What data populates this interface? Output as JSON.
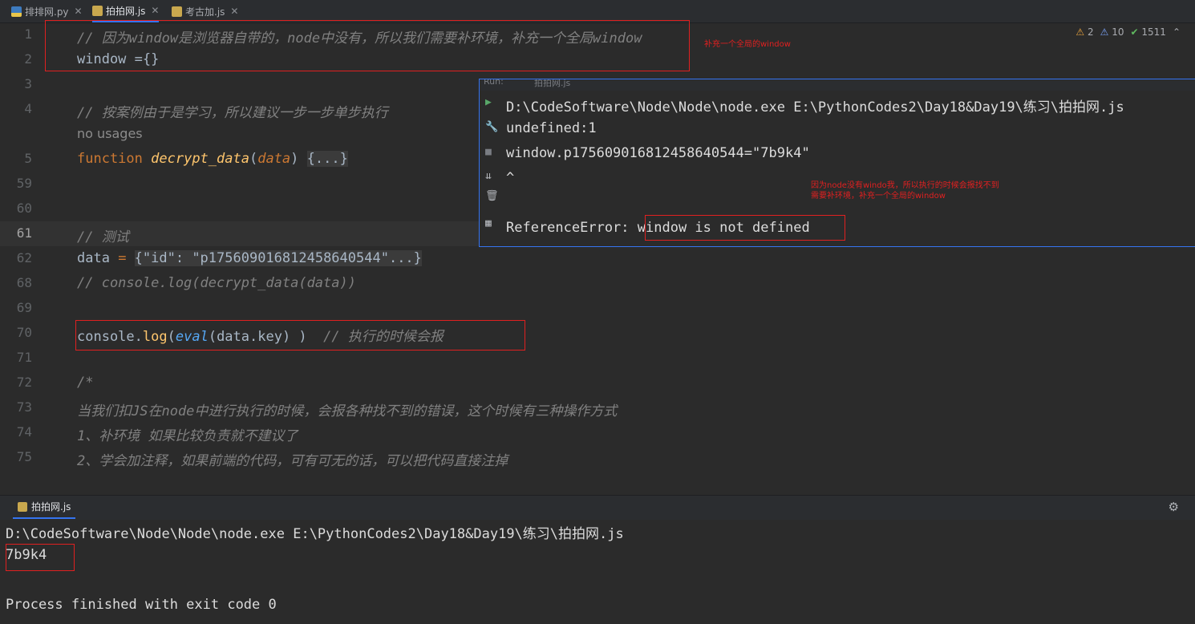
{
  "tabs": [
    {
      "label": "排排网.py",
      "icon": "python-file-icon"
    },
    {
      "label": "拍拍网.js",
      "icon": "js-file-icon"
    },
    {
      "label": "考古加.js",
      "icon": "js-file-icon"
    }
  ],
  "inspections": {
    "warnings": "2",
    "weak_warnings": "10",
    "ok": "1511"
  },
  "line_numbers": [
    "1",
    "2",
    "3",
    "4",
    "5",
    "59",
    "60",
    "61",
    "62",
    "68",
    "69",
    "70",
    "71",
    "72",
    "73",
    "74",
    "75"
  ],
  "code": {
    "l1": "// 因为window是浏览器自带的，node中没有，所以我们需要补环境，补充一个全局window",
    "l2_a": "window ",
    "l2_b": "={}",
    "l4": "// 按案例由于是学习，所以建议一步一步单步执行",
    "no_usages": "no usages",
    "l5_kw": "function",
    "l5_fn": "decrypt_data",
    "l5_open": "(",
    "l5_par": "data",
    "l5_close": ") ",
    "l5_fold": "{...}",
    "l61": "// 测试",
    "l62_a": "data ",
    "l62_eq": "= ",
    "l62_fold": "{\"id\": \"p175609016812458640544\"...}",
    "l68": "// console.log(decrypt_data(data))",
    "l70_a": "console",
    "l70_b": ".",
    "l70_log": "log",
    "l70_c": "(",
    "l70_eval": "eval",
    "l70_d": "(data.key) )  ",
    "l70_com": "// 执行的时候会报",
    "l72": "/*",
    "l73": "当我们扣JS在node中进行执行的时候，会报各种找不到的错误，这个时候有三种操作方式",
    "l74": "1、补环境 如果比较负责就不建议了",
    "l75": "2、学会加注释，如果前端的代码，可有可无的话，可以把代码直接注掉"
  },
  "annotation_top": "补充一个全局的window",
  "popup": {
    "header_run": "Run:",
    "header_tab": "拍拍网.js",
    "line1": "D:\\CodeSoftware\\Node\\Node\\node.exe E:\\PythonCodes2\\Day18&Day19\\练习\\拍拍网.js",
    "line2": "undefined:1",
    "line3": "window.p175609016812458640544=\"7b9k4\"",
    "line4": "^",
    "line5_a": "ReferenceError: ",
    "line5_b": "window is not defined"
  },
  "annotation_popup_1": "因为node没有windo我，所以执行的时候会报找不到",
  "annotation_popup_2": "需要补环境，补充一个全局的window",
  "run_panel": {
    "tab": "拍拍网.js",
    "line1": "D:\\CodeSoftware\\Node\\Node\\node.exe E:\\PythonCodes2\\Day18&Day19\\练习\\拍拍网.js",
    "line2": "7b9k4",
    "line3": "",
    "line4": "Process finished with exit code 0"
  }
}
